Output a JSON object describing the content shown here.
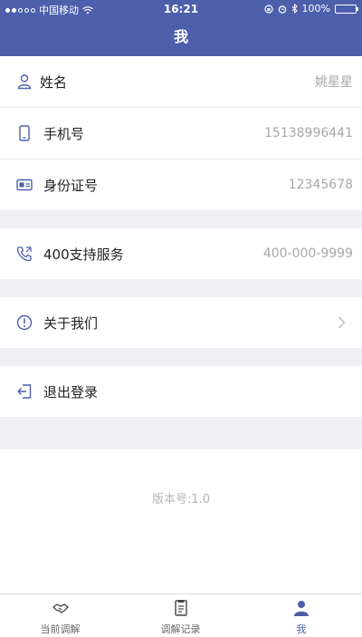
{
  "status_bar": {
    "carrier": "中国移动",
    "time": "16:21",
    "battery": "100%"
  },
  "header": {
    "title": "我"
  },
  "profile": {
    "name_label": "姓名",
    "name_value": "姚星星",
    "phone_label": "手机号",
    "phone_value": "15138996441",
    "id_label": "身份证号",
    "id_value": "12345678"
  },
  "support": {
    "label": "400支持服务",
    "value": "400-000-9999"
  },
  "about": {
    "label": "关于我们"
  },
  "logout": {
    "label": "退出登录"
  },
  "version": "版本号:1.0",
  "tabbar": {
    "tabs": [
      {
        "label": "当前调解",
        "icon": "handshake-icon"
      },
      {
        "label": "调解记录",
        "icon": "records-icon"
      },
      {
        "label": "我",
        "icon": "person-icon",
        "active": true
      }
    ]
  },
  "colors": {
    "brand": "#4d5fab",
    "value_text": "#a7a7a7",
    "background": "#efeff4"
  }
}
